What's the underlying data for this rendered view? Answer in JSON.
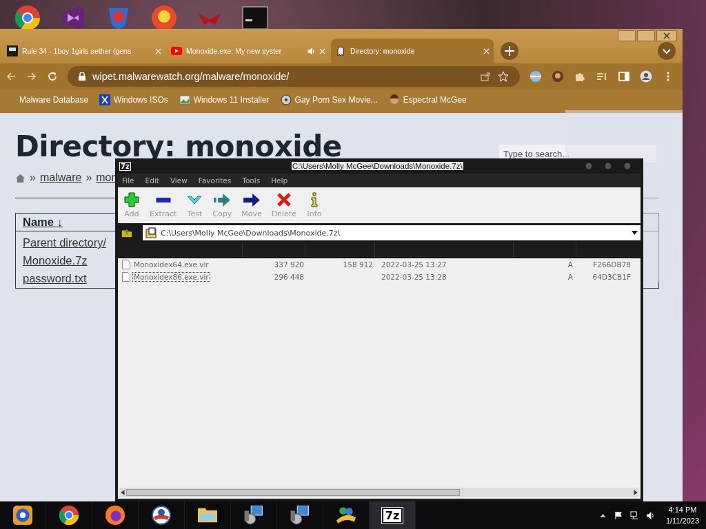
{
  "browser": {
    "tabs": [
      {
        "title": "Rule 34 - 1boy 1girls aether (gens",
        "selected": false,
        "audio": false
      },
      {
        "title": "Monoxide.exe: My new syster",
        "selected": false,
        "audio": true
      },
      {
        "title": "Directory: monoxide",
        "selected": true,
        "audio": false
      }
    ],
    "address": "wipet.malwarewatch.org/malware/monoxide/",
    "bookmarks": [
      {
        "label": "Malware Database"
      },
      {
        "label": "Windows ISOs"
      },
      {
        "label": "Windows 11 Installer"
      },
      {
        "label": "Gay Porn Sex Movie..."
      },
      {
        "label": "Espectral McGee"
      }
    ],
    "page": {
      "heading": "Directory: monoxide",
      "breadcrumb": [
        {
          "separator": "»",
          "label": "malware"
        },
        {
          "separator": "»",
          "label": "mon"
        }
      ],
      "search": {
        "placeholder": "Type to search..."
      },
      "column": "Name ↓",
      "entries": [
        "Parent directory/",
        "Monoxide.7z",
        "password.txt"
      ]
    }
  },
  "archiver": {
    "logo": "7z",
    "title": "C:\\Users\\Molly McGee\\Downloads\\Monoxide.7z\\",
    "menu": [
      "File",
      "Edit",
      "View",
      "Favorites",
      "Tools",
      "Help"
    ],
    "tools": [
      {
        "label": "Add",
        "kind": "add"
      },
      {
        "label": "Extract",
        "kind": "extract"
      },
      {
        "label": "Test",
        "kind": "test"
      },
      {
        "label": "Copy",
        "kind": "copy"
      },
      {
        "label": "Move",
        "kind": "move"
      },
      {
        "label": "Delete",
        "kind": "delete"
      },
      {
        "label": "Info",
        "kind": "info"
      }
    ],
    "path": "C:\\Users\\Molly McGee\\Downloads\\Monoxide.7z\\",
    "files": [
      {
        "column_1": "Monoxidex64.exe.vir",
        "column_2": "337 920",
        "column_3": "158 912",
        "column_4": "2022-03-25 13:27",
        "column_5": "A",
        "column_6": "F266DB78",
        "selected": false
      },
      {
        "column_1": "Monoxidex86.exe.vir",
        "column_2": "296 448",
        "column_4": "2022-03-25 13:28",
        "column_5": "A",
        "column_6": "64D3CB1F",
        "selected": true
      }
    ]
  },
  "taskbar": {
    "apps": [
      {
        "kind": "canary",
        "selected": false
      },
      {
        "kind": "chrome",
        "selected": false
      },
      {
        "kind": "firefox",
        "selected": false
      },
      {
        "kind": "circle",
        "selected": false
      },
      {
        "kind": "folder",
        "selected": false
      },
      {
        "kind": "installer",
        "selected": false
      },
      {
        "kind": "installer",
        "selected": false
      },
      {
        "kind": "messenger",
        "selected": false
      },
      {
        "kind": "sevenzip",
        "label": "7z",
        "selected": true
      }
    ],
    "time": "4:14 PM",
    "date": "1/11/2023"
  }
}
